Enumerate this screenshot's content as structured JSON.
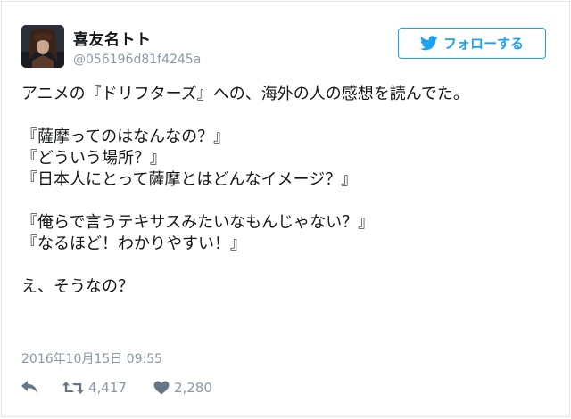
{
  "user": {
    "display_name": "喜友名トト",
    "screen_name": "@056196d81f4245a"
  },
  "follow_button": {
    "label": "フォローする",
    "icon": "twitter-bird-icon"
  },
  "tweet": {
    "lines": [
      "アニメの『ドリフターズ』への、海外の人の感想を読んでた。",
      "",
      "『薩摩ってのはなんなの？』",
      "『どういう場所？』",
      "『日本人にとって薩摩とはどんなイメージ？』",
      "",
      "『俺らで言うテキサスみたいなもんじゃない？』",
      "『なるほど！わかりやすい！』",
      "",
      "え、そうなの？"
    ],
    "timestamp": "2016年10月15日 09:55"
  },
  "actions": {
    "reply_icon": "reply-icon",
    "retweet_icon": "retweet-icon",
    "retweet_count": "4,417",
    "like_icon": "heart-icon",
    "like_count": "2,280"
  },
  "colors": {
    "accent": "#1da1f2",
    "muted": "#8899a6",
    "text": "#14171a",
    "border": "#e1e8ed"
  }
}
